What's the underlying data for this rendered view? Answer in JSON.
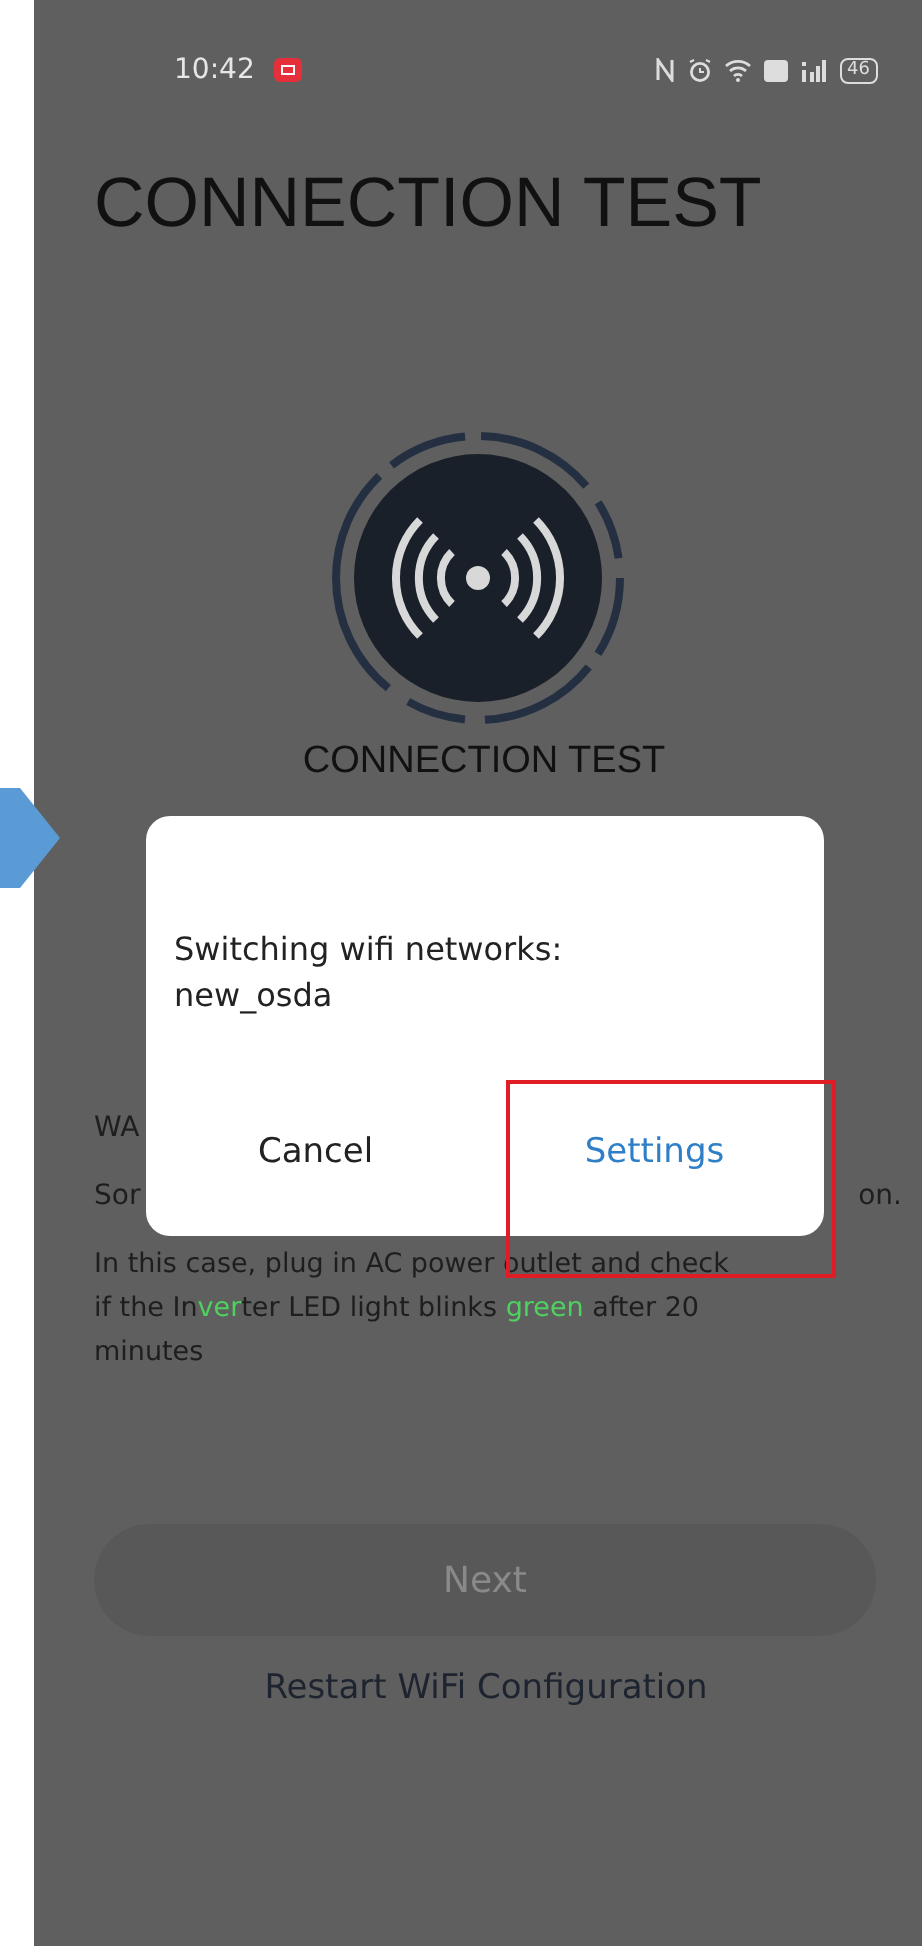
{
  "status_bar": {
    "time": "10:42",
    "battery": "46"
  },
  "title": "CONNECTION TEST",
  "status_label": "CONNECTION TEST",
  "warning": {
    "title": "WA",
    "line_start": "Sor",
    "line_end": "on.",
    "lines": [
      [
        {
          "text": "In this case, plug in AC power outlet and check",
          "highlight": false
        }
      ],
      [
        {
          "text": "if the In",
          "highlight": false
        },
        {
          "text": "ver",
          "highlight": true
        },
        {
          "text": "ter LED light blinks ",
          "highlight": false
        },
        {
          "text": "green",
          "highlight": true
        },
        {
          "text": " after 20",
          "highlight": false
        }
      ],
      [
        {
          "text": "minutes",
          "highlight": false
        }
      ]
    ]
  },
  "next_button": {
    "label": "Next",
    "disabled": true
  },
  "restart_link": "Restart WiFi Configuration",
  "dialog": {
    "message": "Switching wifi networks:",
    "network": "new_osda",
    "buttons": [
      {
        "label": "Cancel",
        "kind": "neutral",
        "highlighted": false
      },
      {
        "label": "Settings",
        "kind": "primary",
        "highlighted": true
      }
    ]
  }
}
